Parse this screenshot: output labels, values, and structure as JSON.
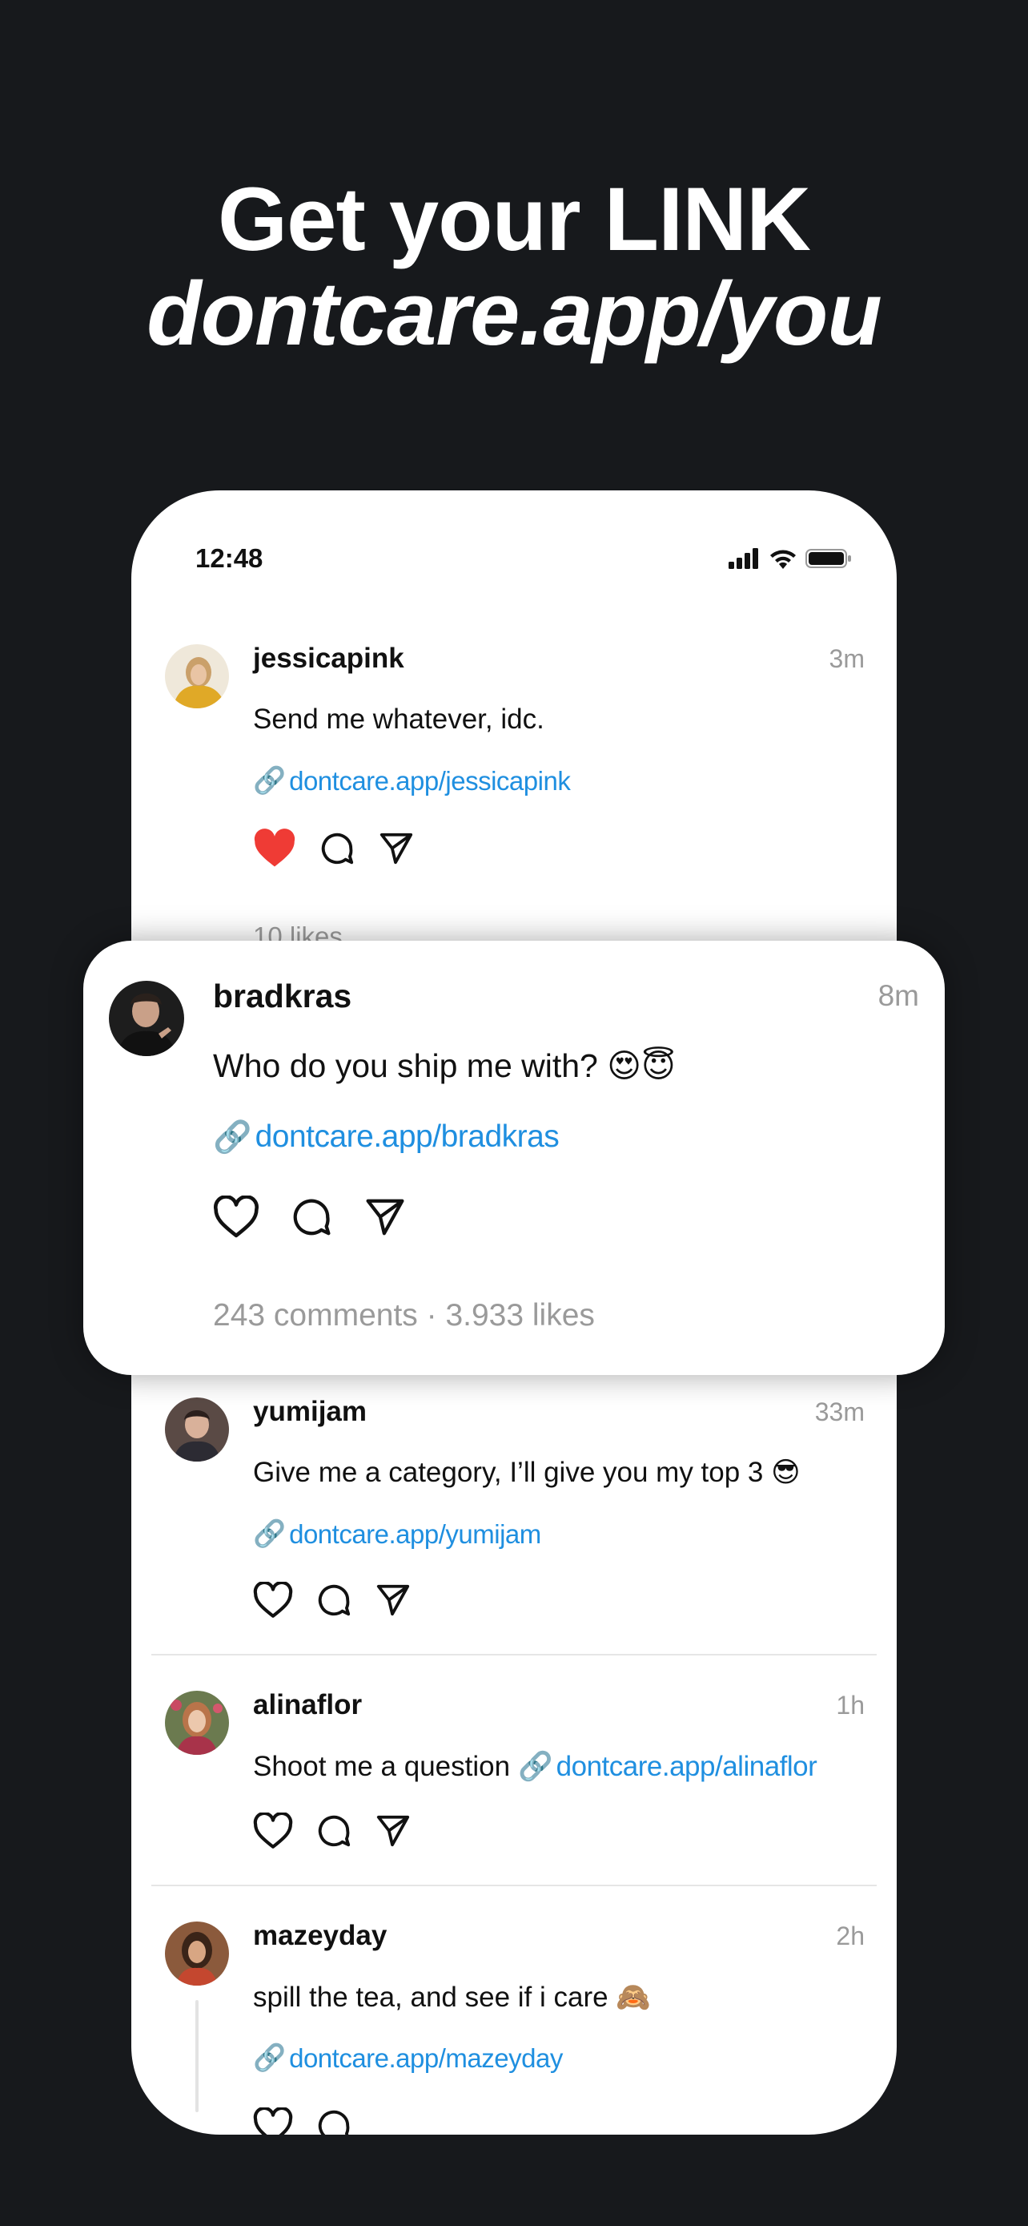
{
  "headline": {
    "line1": "Get your LINK",
    "line2": "dontcare.app/you"
  },
  "status_bar": {
    "time": "12:48"
  },
  "link_glyph": "🔗",
  "posts": [
    {
      "username": "jessicapink",
      "time": "3m",
      "text": "Send me whatever, idc.",
      "link": "dontcare.app/jessicapink",
      "liked": true,
      "stats": "10 likes"
    },
    {
      "username": "yumijam",
      "time": "33m",
      "text": "Give me a category, I’ll give you my top 3 😎",
      "link": "dontcare.app/yumijam",
      "liked": false
    },
    {
      "username": "alinaflor",
      "time": "1h",
      "text": "Shoot me a question",
      "link": "dontcare.app/alinaflor",
      "liked": false
    },
    {
      "username": "mazeyday",
      "time": "2h",
      "text": "spill the tea, and see if i care 🙈",
      "link": "dontcare.app/mazeyday",
      "liked": false
    }
  ],
  "featured": {
    "username": "bradkras",
    "time": "8m",
    "text": "Who do you ship me with?  😍😇",
    "link": "dontcare.app/bradkras",
    "liked": false,
    "stats": "243 comments · 3.933 likes"
  },
  "colors": {
    "background": "#17191c",
    "link": "#1f8fe0",
    "like": "#ef3b35",
    "muted": "#9a9a9a"
  },
  "icons": {
    "like": "heart-icon",
    "comment": "comment-icon",
    "share": "send-icon",
    "link": "link-icon"
  }
}
